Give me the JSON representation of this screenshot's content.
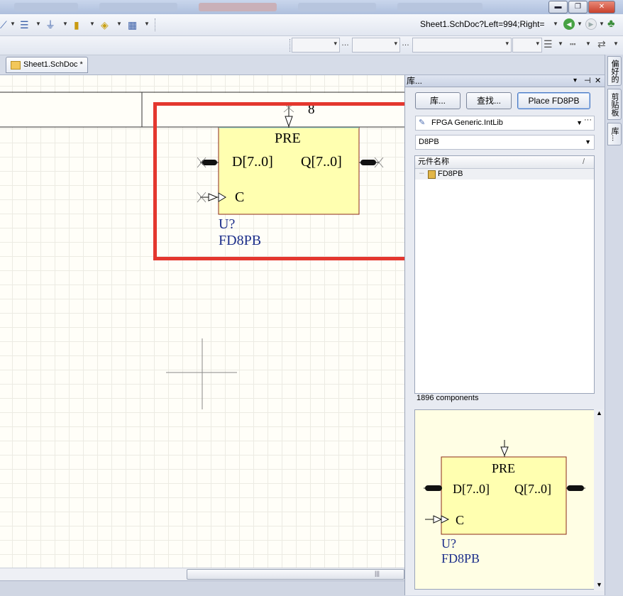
{
  "window": {
    "controls": {
      "minimize": "▬",
      "maximize": "❐",
      "close": "✕"
    }
  },
  "toolbar": {
    "address_value": "Sheet1.SchDoc?Left=994;Right=",
    "icons": [
      "line-icon",
      "bus-icon",
      "ground-icon",
      "power-port-icon",
      "net-label-icon",
      "grid-icon"
    ],
    "nav": {
      "back": "◀",
      "forward": "▶"
    }
  },
  "document_tab": {
    "label": "Sheet1.SchDoc *"
  },
  "canvas": {
    "component": {
      "pin_top_number": "8",
      "pre_label": "PRE",
      "d_label": "D[7..0]",
      "q_label": "Q[7..0]",
      "clock_label": "C",
      "designator": "U?",
      "comment": "FD8PB",
      "body_color": "#ffffb0",
      "body_border": "#8b2a1a"
    },
    "highlight_color": "#e4372f"
  },
  "library_panel": {
    "title": "库...",
    "header_controls": {
      "menu": "▾",
      "pin": "⊣",
      "close": "✕"
    },
    "buttons": {
      "libraries": "库...",
      "search": "查找...",
      "place": "Place FD8PB"
    },
    "library_select": {
      "value": "FPGA Generic.IntLib"
    },
    "filter_value": "D8PB",
    "list_header": "元件名称",
    "list_sort": "/",
    "items": [
      "FD8PB"
    ],
    "count_text": "1896 components",
    "preview": {
      "pre_label": "PRE",
      "d_label": "D[7..0]",
      "q_label": "Q[7..0]",
      "clock_label": "C",
      "designator": "U?",
      "comment": "FD8PB"
    }
  },
  "side_tabs": [
    "偏好的",
    "剪贴板",
    "库..."
  ]
}
